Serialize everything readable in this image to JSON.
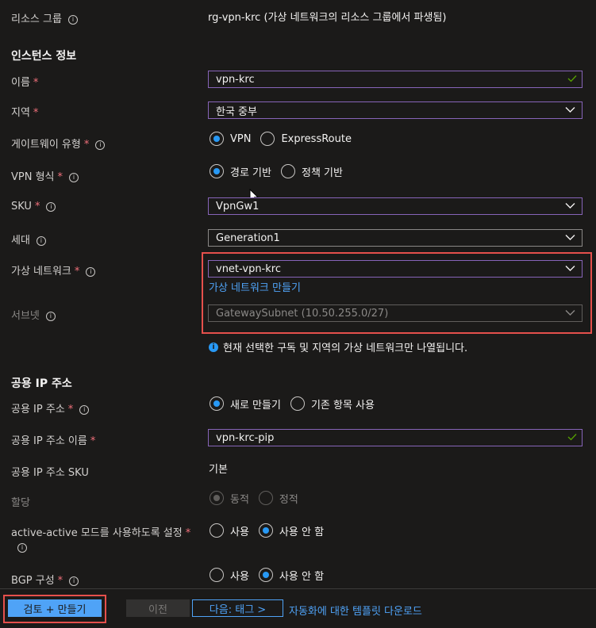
{
  "resource_group": {
    "label": "리소스 그룹",
    "value": "rg-vpn-krc (가상 네트워크의 리소스 그룹에서 파생됨)"
  },
  "instance_section": {
    "title": "인스턴스 정보"
  },
  "name": {
    "label": "이름",
    "value": "vpn-krc"
  },
  "region": {
    "label": "지역",
    "value": "한국 중부"
  },
  "gateway_type": {
    "label": "게이트웨이 유형",
    "options": [
      "VPN",
      "ExpressRoute"
    ],
    "selected": "VPN"
  },
  "vpn_type": {
    "label": "VPN 형식",
    "options": [
      "경로 기반",
      "정책 기반"
    ],
    "selected": "경로 기반"
  },
  "sku": {
    "label": "SKU",
    "value": "VpnGw1"
  },
  "generation": {
    "label": "세대",
    "value": "Generation1"
  },
  "vnet": {
    "label": "가상 네트워크",
    "value": "vnet-vpn-krc",
    "create_link": "가상 네트워크 만들기"
  },
  "subnet": {
    "label": "서브넷",
    "value": "GatewaySubnet (10.50.255.0/27)"
  },
  "subnet_info": "현재 선택한 구독 및 지역의 가상 네트워크만 나열됩니다.",
  "public_ip_section": {
    "title": "공용 IP 주소"
  },
  "public_ip": {
    "label": "공용 IP 주소",
    "options": [
      "새로 만들기",
      "기존 항목 사용"
    ],
    "selected": "새로 만들기"
  },
  "public_ip_name": {
    "label": "공용 IP 주소 이름",
    "value": "vpn-krc-pip"
  },
  "public_ip_sku": {
    "label": "공용 IP 주소 SKU",
    "value": "기본"
  },
  "assignment": {
    "label": "할당",
    "options": [
      "동적",
      "정적"
    ],
    "selected": "동적"
  },
  "active_active": {
    "label": "active-active 모드를 사용하도록 설정",
    "options": [
      "사용",
      "사용 안 함"
    ],
    "selected": "사용 안 함"
  },
  "bgp": {
    "label": "BGP 구성",
    "options": [
      "사용",
      "사용 안 함"
    ],
    "selected": "사용 안 함"
  },
  "footer": {
    "review_create": "검토 + 만들기",
    "previous": "이전",
    "next": "다음: 태그 >",
    "download_template": "자동화에 대한 템플릿 다운로드"
  },
  "required_mark": "*",
  "info_glyph": "i",
  "colors": {
    "accent": "#2899f5",
    "primary_button": "#4fa3f7",
    "focus_border": "#8764b8",
    "highlight": "#e5504c",
    "link": "#4fa3f7"
  }
}
